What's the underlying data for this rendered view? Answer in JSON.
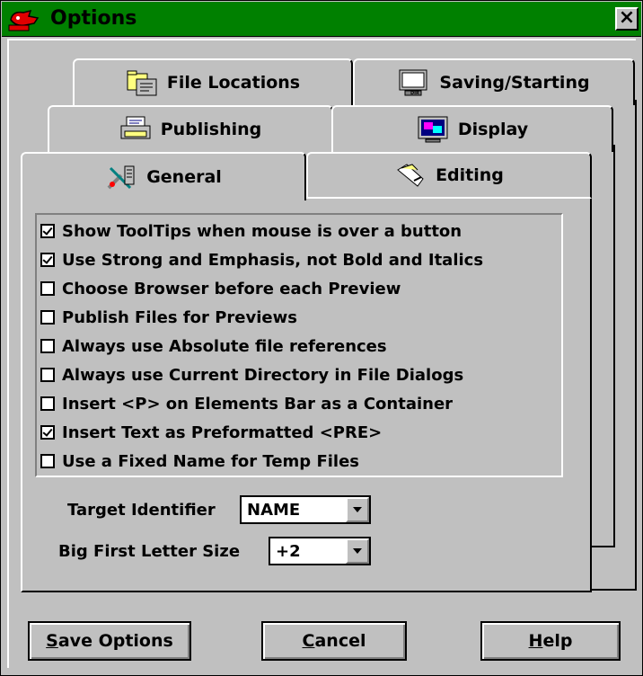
{
  "window": {
    "title": "Options",
    "close_glyph": "×"
  },
  "tabs": {
    "file_locations": "File Locations",
    "saving_starting": "Saving/Starting",
    "publishing": "Publishing",
    "display": "Display",
    "general": "General",
    "editing": "Editing",
    "active": "General"
  },
  "options": [
    {
      "label": "Show ToolTips when mouse is over a button",
      "checked": true
    },
    {
      "label": "Use Strong and Emphasis, not Bold and Italics",
      "checked": true
    },
    {
      "label": "Choose Browser before each Preview",
      "checked": false
    },
    {
      "label": "Publish Files for Previews",
      "checked": false
    },
    {
      "label": "Always use Absolute file references",
      "checked": false
    },
    {
      "label": "Always use Current Directory in File Dialogs",
      "checked": false
    },
    {
      "label": "Insert <P> on Elements Bar as a Container",
      "checked": false
    },
    {
      "label": "Insert Text as Preformatted <PRE>",
      "checked": true
    },
    {
      "label": "Use a Fixed Name for Temp Files",
      "checked": false
    }
  ],
  "fields": {
    "target_identifier": {
      "label": "Target Identifier",
      "value": "NAME"
    },
    "big_first_letter": {
      "label": "Big First Letter Size",
      "value": "+2"
    }
  },
  "buttons": {
    "save": {
      "mnemonic": "S",
      "rest": "ave Options"
    },
    "cancel": {
      "mnemonic": "C",
      "rest": "ancel"
    },
    "help": {
      "mnemonic": "H",
      "rest": "elp"
    }
  },
  "colors": {
    "title_bar": "#008000",
    "face": "#c0c0c0"
  }
}
